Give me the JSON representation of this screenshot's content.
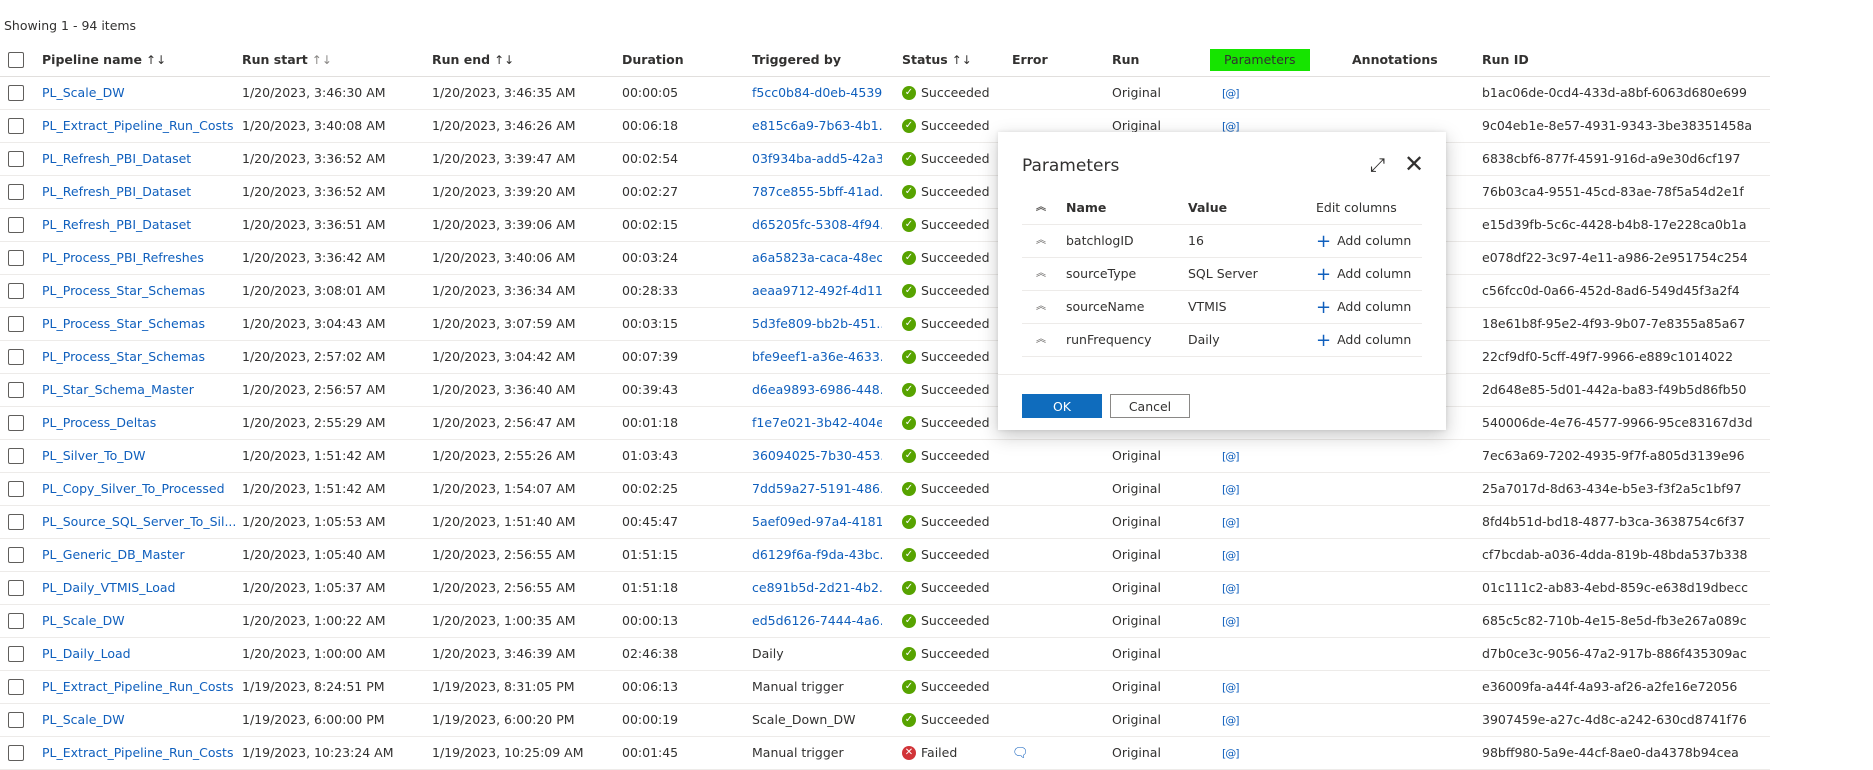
{
  "summary": "Showing 1 - 94 items",
  "columns": {
    "name": "Pipeline name",
    "start": "Run start",
    "end": "Run end",
    "duration": "Duration",
    "trigger": "Triggered by",
    "status": "Status",
    "error": "Error",
    "run": "Run",
    "params": "Parameters",
    "annotations": "Annotations",
    "runid": "Run ID"
  },
  "sort_icon": "↑↓",
  "param_icon": "[@]",
  "rows": [
    {
      "name": "PL_Scale_DW",
      "start": "1/20/2023, 3:46:30 AM",
      "end": "1/20/2023, 3:46:35 AM",
      "duration": "00:00:05",
      "trigger": "f5cc0b84-d0eb-4539...",
      "status": "Succeeded",
      "run": "Original",
      "param": "[@]",
      "runid": "b1ac06de-0cd4-433d-a8bf-6063d680e699"
    },
    {
      "name": "PL_Extract_Pipeline_Run_Costs",
      "start": "1/20/2023, 3:40:08 AM",
      "end": "1/20/2023, 3:46:26 AM",
      "duration": "00:06:18",
      "trigger": "e815c6a9-7b63-4b1...",
      "status": "Succeeded",
      "run": "Original",
      "param": "[@]",
      "runid": "9c04eb1e-8e57-4931-9343-3be38351458a"
    },
    {
      "name": "PL_Refresh_PBI_Dataset",
      "start": "1/20/2023, 3:36:52 AM",
      "end": "1/20/2023, 3:39:47 AM",
      "duration": "00:02:54",
      "trigger": "03f934ba-add5-42a3...",
      "status": "Succeeded",
      "run": "",
      "param": "",
      "runid": "6838cbf6-877f-4591-916d-a9e30d6cf197"
    },
    {
      "name": "PL_Refresh_PBI_Dataset",
      "start": "1/20/2023, 3:36:52 AM",
      "end": "1/20/2023, 3:39:20 AM",
      "duration": "00:02:27",
      "trigger": "787ce855-5bff-41ad...",
      "status": "Succeeded",
      "run": "",
      "param": "",
      "runid": "76b03ca4-9551-45cd-83ae-78f5a54d2e1f"
    },
    {
      "name": "PL_Refresh_PBI_Dataset",
      "start": "1/20/2023, 3:36:51 AM",
      "end": "1/20/2023, 3:39:06 AM",
      "duration": "00:02:15",
      "trigger": "d65205fc-5308-4f94...",
      "status": "Succeeded",
      "run": "",
      "param": "",
      "runid": "e15d39fb-5c6c-4428-b4b8-17e228ca0b1a"
    },
    {
      "name": "PL_Process_PBI_Refreshes",
      "start": "1/20/2023, 3:36:42 AM",
      "end": "1/20/2023, 3:40:06 AM",
      "duration": "00:03:24",
      "trigger": "a6a5823a-caca-48ec...",
      "status": "Succeeded",
      "run": "",
      "param": "",
      "runid": "e078df22-3c97-4e11-a986-2e951754c254"
    },
    {
      "name": "PL_Process_Star_Schemas",
      "start": "1/20/2023, 3:08:01 AM",
      "end": "1/20/2023, 3:36:34 AM",
      "duration": "00:28:33",
      "trigger": "aeaa9712-492f-4d11...",
      "status": "Succeeded",
      "run": "",
      "param": "",
      "runid": "c56fcc0d-0a66-452d-8ad6-549d45f3a2f4"
    },
    {
      "name": "PL_Process_Star_Schemas",
      "start": "1/20/2023, 3:04:43 AM",
      "end": "1/20/2023, 3:07:59 AM",
      "duration": "00:03:15",
      "trigger": "5d3fe809-bb2b-451...",
      "status": "Succeeded",
      "run": "",
      "param": "",
      "runid": "18e61b8f-95e2-4f93-9b07-7e8355a85a67"
    },
    {
      "name": "PL_Process_Star_Schemas",
      "start": "1/20/2023, 2:57:02 AM",
      "end": "1/20/2023, 3:04:42 AM",
      "duration": "00:07:39",
      "trigger": "bfe9eef1-a36e-4633...",
      "status": "Succeeded",
      "run": "",
      "param": "",
      "runid": "22cf9df0-5cff-49f7-9966-e889c1014022"
    },
    {
      "name": "PL_Star_Schema_Master",
      "start": "1/20/2023, 2:56:57 AM",
      "end": "1/20/2023, 3:36:40 AM",
      "duration": "00:39:43",
      "trigger": "d6ea9893-6986-448...",
      "status": "Succeeded",
      "run": "",
      "param": "",
      "runid": "2d648e85-5d01-442a-ba83-f49b5d86fb50"
    },
    {
      "name": "PL_Process_Deltas",
      "start": "1/20/2023, 2:55:29 AM",
      "end": "1/20/2023, 2:56:47 AM",
      "duration": "00:01:18",
      "trigger": "f1e7e021-3b42-404e...",
      "status": "Succeeded",
      "run": "",
      "param": "",
      "runid": "540006de-4e76-4577-9966-95ce83167d3d"
    },
    {
      "name": "PL_Silver_To_DW",
      "start": "1/20/2023, 1:51:42 AM",
      "end": "1/20/2023, 2:55:26 AM",
      "duration": "01:03:43",
      "trigger": "36094025-7b30-453...",
      "status": "Succeeded",
      "run": "Original",
      "param": "[@]",
      "runid": "7ec63a69-7202-4935-9f7f-a805d3139e96"
    },
    {
      "name": "PL_Copy_Silver_To_Processed",
      "start": "1/20/2023, 1:51:42 AM",
      "end": "1/20/2023, 1:54:07 AM",
      "duration": "00:02:25",
      "trigger": "7dd59a27-5191-486...",
      "status": "Succeeded",
      "run": "Original",
      "param": "[@]",
      "runid": "25a7017d-8d63-434e-b5e3-f3f2a5c1bf97"
    },
    {
      "name": "PL_Source_SQL_Server_To_Sil...",
      "start": "1/20/2023, 1:05:53 AM",
      "end": "1/20/2023, 1:51:40 AM",
      "duration": "00:45:47",
      "trigger": "5aef09ed-97a4-4181...",
      "status": "Succeeded",
      "run": "Original",
      "param": "[@]",
      "runid": "8fd4b51d-bd18-4877-b3ca-3638754c6f37"
    },
    {
      "name": "PL_Generic_DB_Master",
      "start": "1/20/2023, 1:05:40 AM",
      "end": "1/20/2023, 2:56:55 AM",
      "duration": "01:51:15",
      "trigger": "d6129f6a-f9da-43bc...",
      "status": "Succeeded",
      "run": "Original",
      "param": "[@]",
      "runid": "cf7bcdab-a036-4dda-819b-48bda537b338"
    },
    {
      "name": "PL_Daily_VTMIS_Load",
      "start": "1/20/2023, 1:05:37 AM",
      "end": "1/20/2023, 2:56:55 AM",
      "duration": "01:51:18",
      "trigger": "ce891b5d-2d21-4b2...",
      "status": "Succeeded",
      "run": "Original",
      "param": "[@]",
      "runid": "01c111c2-ab83-4ebd-859c-e638d19dbecc"
    },
    {
      "name": "PL_Scale_DW",
      "start": "1/20/2023, 1:00:22 AM",
      "end": "1/20/2023, 1:00:35 AM",
      "duration": "00:00:13",
      "trigger": "ed5d6126-7444-4a6...",
      "status": "Succeeded",
      "run": "Original",
      "param": "[@]",
      "runid": "685c5c82-710b-4e15-8e5d-fb3e267a089c"
    },
    {
      "name": "PL_Daily_Load",
      "start": "1/20/2023, 1:00:00 AM",
      "end": "1/20/2023, 3:46:39 AM",
      "duration": "02:46:38",
      "trigger": "Daily",
      "status": "Succeeded",
      "run": "Original",
      "param": "",
      "runid": "d7b0ce3c-9056-47a2-917b-886f435309ac"
    },
    {
      "name": "PL_Extract_Pipeline_Run_Costs",
      "start": "1/19/2023, 8:24:51 PM",
      "end": "1/19/2023, 8:31:05 PM",
      "duration": "00:06:13",
      "trigger": "Manual trigger",
      "status": "Succeeded",
      "run": "Original",
      "param": "[@]",
      "runid": "e36009fa-a44f-4a93-af26-a2fe16e72056"
    },
    {
      "name": "PL_Scale_DW",
      "start": "1/19/2023, 6:00:00 PM",
      "end": "1/19/2023, 6:00:20 PM",
      "duration": "00:00:19",
      "trigger": "Scale_Down_DW",
      "status": "Succeeded",
      "run": "Original",
      "param": "[@]",
      "runid": "3907459e-a27c-4d8c-a242-630cd8741f76"
    },
    {
      "name": "PL_Extract_Pipeline_Run_Costs",
      "start": "1/19/2023, 10:23:24 AM",
      "end": "1/19/2023, 10:25:09 AM",
      "duration": "00:01:45",
      "trigger": "Manual trigger",
      "status": "Failed",
      "run": "Original",
      "param": "[@]",
      "runid": "98bff980-5a9e-44cf-8ae0-da4378b94cea"
    }
  ],
  "dialog": {
    "title": "Parameters",
    "col_name": "Name",
    "col_value": "Value",
    "col_edit": "Edit columns",
    "add_label": "Add column",
    "params": [
      {
        "name": "batchlogID",
        "value": "16"
      },
      {
        "name": "sourceType",
        "value": "SQL Server"
      },
      {
        "name": "sourceName",
        "value": "VTMIS"
      },
      {
        "name": "runFrequency",
        "value": "Daily"
      }
    ],
    "ok": "OK",
    "cancel": "Cancel"
  },
  "colors": {
    "accent": "#0f6cbd",
    "link": "#0f5fbd",
    "success": "#57a300",
    "failed": "#d13438",
    "highlight": "#16e400"
  }
}
